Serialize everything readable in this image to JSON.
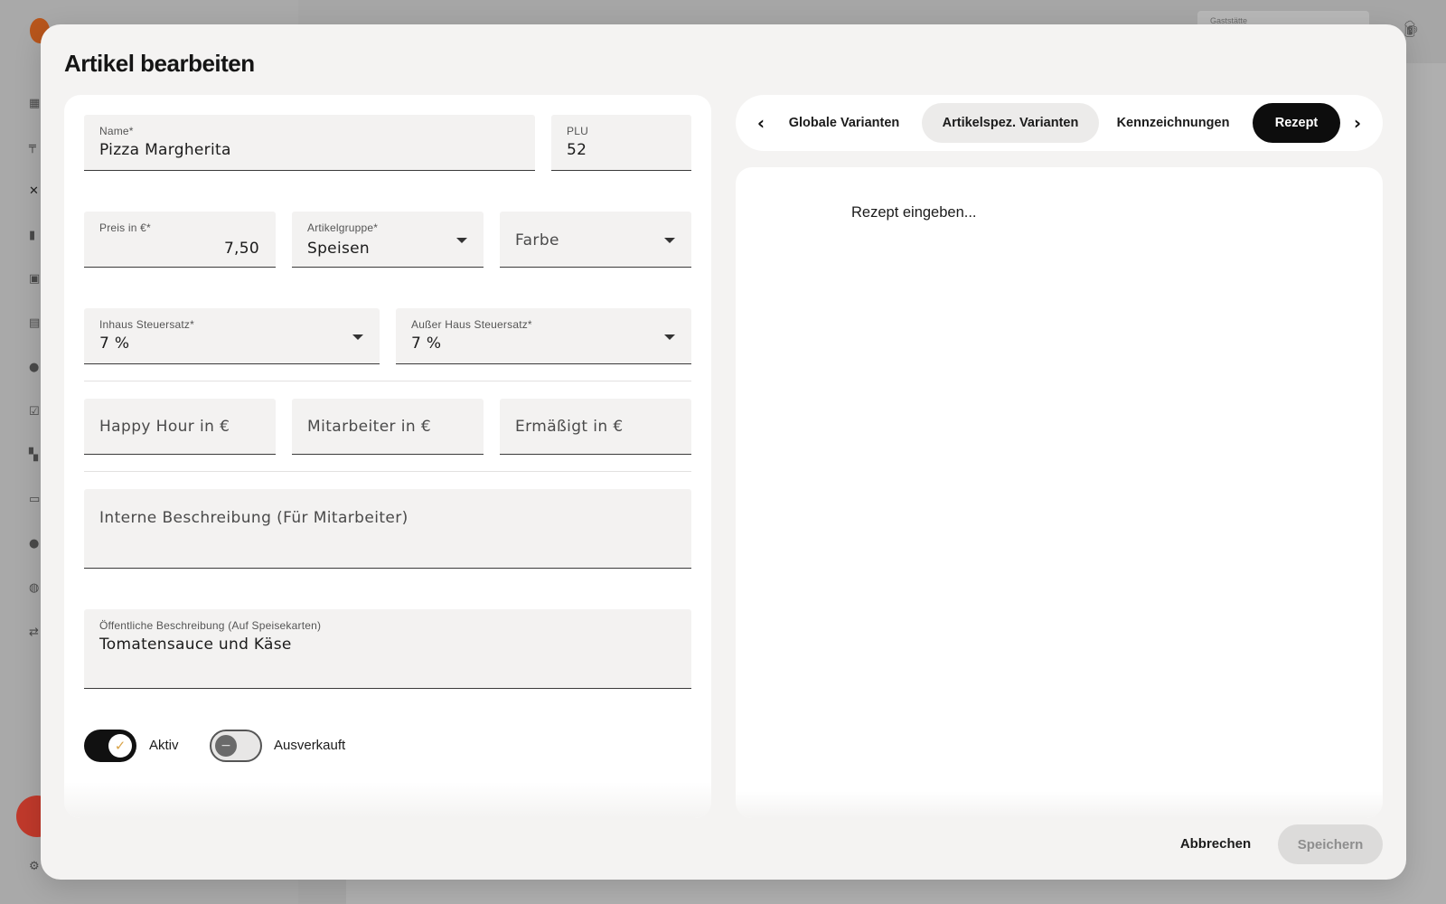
{
  "background": {
    "header_field_label": "Gaststätte",
    "nav_icons": [
      "dashboard-icon",
      "table-icon",
      "cutlery-icon",
      "chart-icon",
      "inbox-icon",
      "gift-icon",
      "users-icon",
      "calendar-check-icon",
      "qr-code-icon",
      "archive-icon",
      "staff-icon",
      "globe-icon",
      "transfer-icon",
      "settings-icon"
    ]
  },
  "modal": {
    "title": "Artikel bearbeiten",
    "form": {
      "name": {
        "label": "Name*",
        "value": "Pizza Margherita"
      },
      "plu": {
        "label": "PLU",
        "value": "52"
      },
      "price": {
        "label": "Preis in €*",
        "value": "7,50"
      },
      "group": {
        "label": "Artikelgruppe*",
        "value": "Speisen"
      },
      "color": {
        "placeholder": "Farbe"
      },
      "tax_in": {
        "label": "Inhaus Steuersatz*",
        "value": "7 %"
      },
      "tax_out": {
        "label": "Außer Haus Steuersatz*",
        "value": "7 %"
      },
      "happy_hour": {
        "placeholder": "Happy Hour in €"
      },
      "staff_price": {
        "placeholder": "Mitarbeiter in €"
      },
      "reduced_price": {
        "placeholder": "Ermäßigt in €"
      },
      "internal_desc": {
        "placeholder": "Interne Beschreibung (Für Mitarbeiter)"
      },
      "public_desc": {
        "label": "Öffentliche Beschreibung (Auf Speisekarten)",
        "value": "Tomatensauce und Käse"
      },
      "toggle_active": {
        "label": "Aktiv",
        "on": true
      },
      "toggle_soldout": {
        "label": "Ausverkauft",
        "on": false
      }
    },
    "tabs": [
      {
        "label": "Globale Varianten",
        "state": "normal"
      },
      {
        "label": "Artikelspez. Varianten",
        "state": "hover"
      },
      {
        "label": "Kennzeichnungen",
        "state": "normal"
      },
      {
        "label": "Rezept",
        "state": "active"
      }
    ],
    "recipe": {
      "placeholder": "Rezept eingeben..."
    },
    "actions": {
      "cancel": "Abbrechen",
      "save": "Speichern"
    }
  }
}
